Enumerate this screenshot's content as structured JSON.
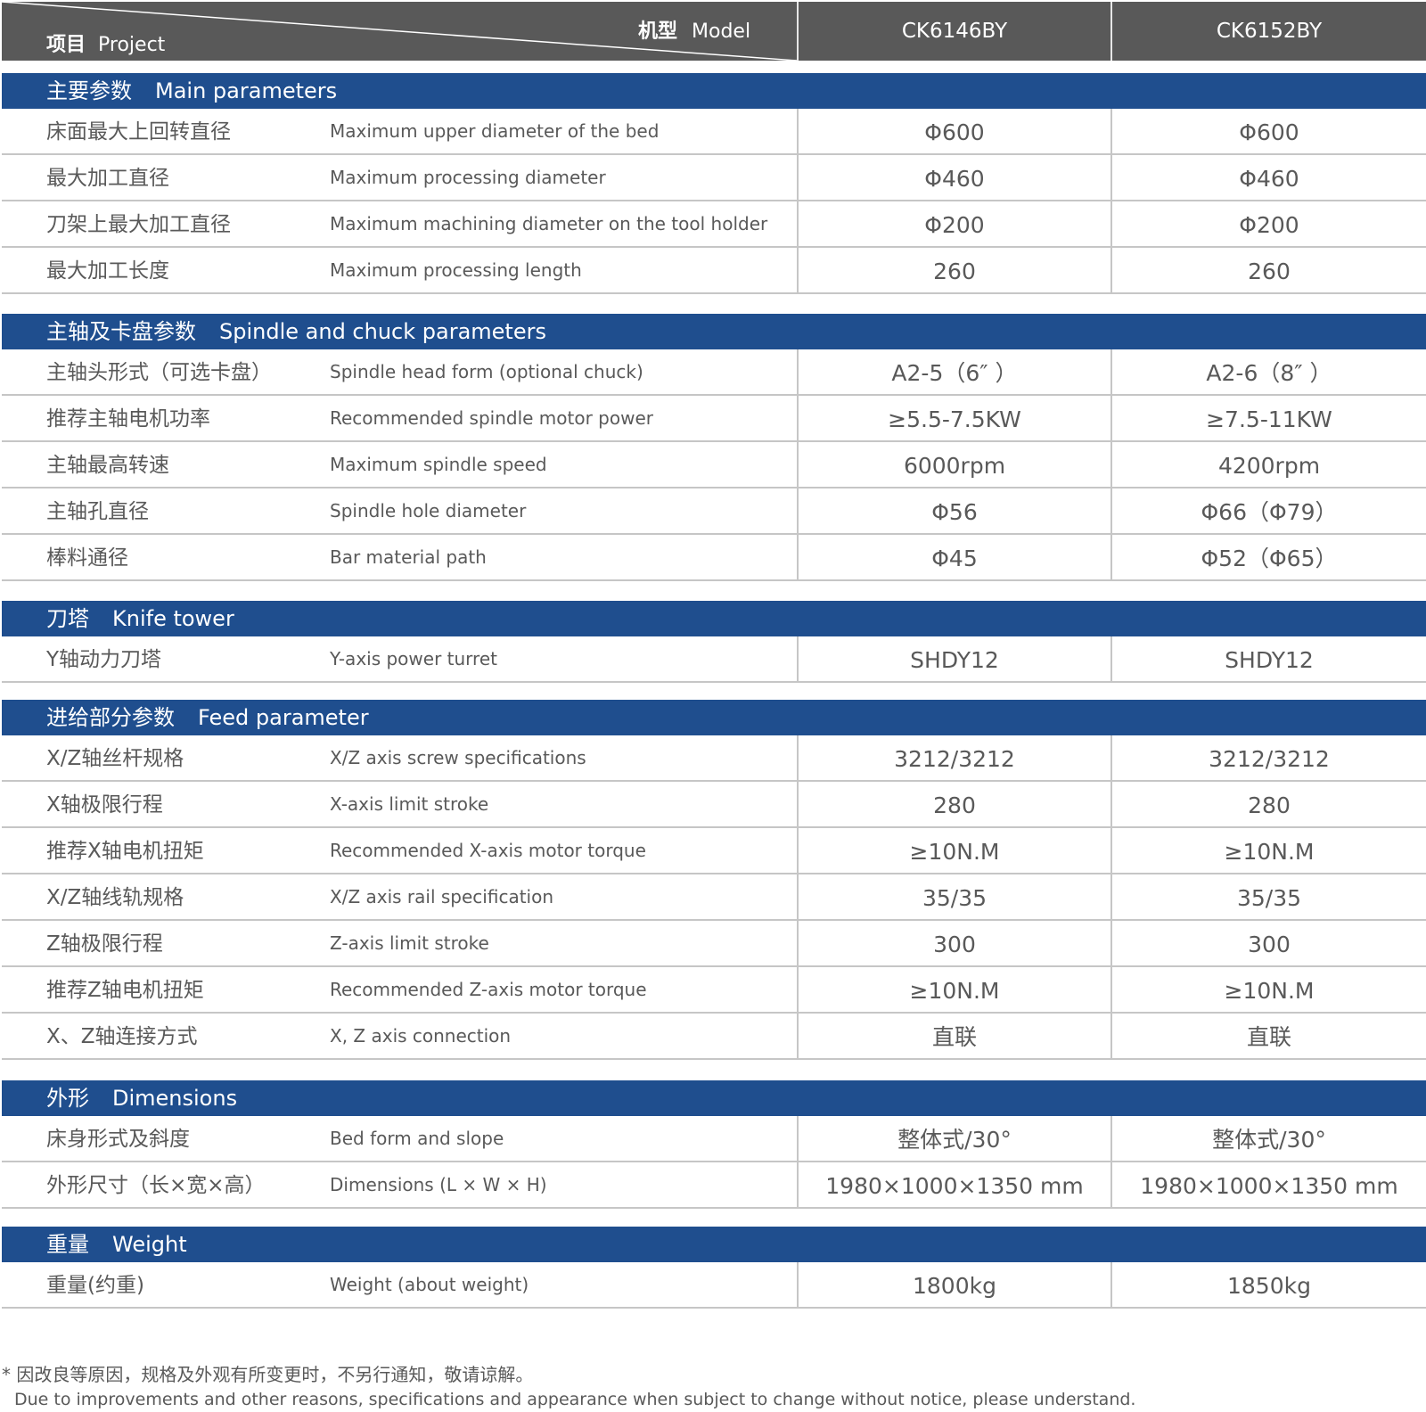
{
  "header": {
    "project_cn": "项目",
    "project_en": "Project",
    "model_cn": "机型",
    "model_en": "Model",
    "models": [
      "CK6146BY",
      "CK6152BY"
    ]
  },
  "sections": [
    {
      "title_cn": "主要参数",
      "title_en": "Main parameters",
      "rows": [
        {
          "cn": "床面最大上回转直径",
          "en": "Maximum upper diameter of the bed",
          "v1": "Φ600",
          "v2": "Φ600"
        },
        {
          "cn": "最大加工直径",
          "en": "Maximum processing diameter",
          "v1": "Φ460",
          "v2": "Φ460"
        },
        {
          "cn": "刀架上最大加工直径",
          "en": "Maximum machining diameter on the tool holder",
          "v1": "Φ200",
          "v2": "Φ200"
        },
        {
          "cn": "最大加工长度",
          "en": "Maximum processing length",
          "v1": "260",
          "v2": "260"
        }
      ]
    },
    {
      "title_cn": "主轴及卡盘参数",
      "title_en": "Spindle and chuck parameters",
      "rows": [
        {
          "cn": "主轴头形式（可选卡盘）",
          "en": "Spindle head form (optional chuck)",
          "v1": "A2-5（6″ ）",
          "v2": "A2-6（8″ ）"
        },
        {
          "cn": "推荐主轴电机功率",
          "en": "Recommended spindle motor power",
          "v1": "≥5.5-7.5KW",
          "v2": "≥7.5-11KW"
        },
        {
          "cn": "主轴最高转速",
          "en": "Maximum spindle speed",
          "v1": "6000rpm",
          "v2": "4200rpm"
        },
        {
          "cn": "主轴孔直径",
          "en": "Spindle hole diameter",
          "v1": "Φ56",
          "v2": "Φ66（Φ79）"
        },
        {
          "cn": "棒料通径",
          "en": "Bar material path",
          "v1": "Φ45",
          "v2": "Φ52（Φ65）"
        }
      ]
    },
    {
      "title_cn": "刀塔",
      "title_en": "Knife tower",
      "rows": [
        {
          "cn": "Y轴动力刀塔",
          "en": "Y-axis power turret",
          "v1": "SHDY12",
          "v2": "SHDY12"
        }
      ]
    },
    {
      "title_cn": "进给部分参数",
      "title_en": "Feed parameter",
      "rows": [
        {
          "cn": "X/Z轴丝杆规格",
          "en": "X/Z axis screw specifications",
          "v1": "3212/3212",
          "v2": "3212/3212"
        },
        {
          "cn": "X轴极限行程",
          "en": "X-axis limit stroke",
          "v1": "280",
          "v2": "280"
        },
        {
          "cn": "推荐X轴电机扭矩",
          "en": "Recommended X-axis motor torque",
          "v1": "≥10N.M",
          "v2": "≥10N.M"
        },
        {
          "cn": "X/Z轴线轨规格",
          "en": "X/Z axis rail specification",
          "v1": "35/35",
          "v2": "35/35"
        },
        {
          "cn": "Z轴极限行程",
          "en": "Z-axis limit stroke",
          "v1": "300",
          "v2": "300"
        },
        {
          "cn": "推荐Z轴电机扭矩",
          "en": "Recommended Z-axis motor torque",
          "v1": "≥10N.M",
          "v2": "≥10N.M"
        },
        {
          "cn": "X、Z轴连接方式",
          "en": "X, Z axis connection",
          "v1": "直联",
          "v2": "直联"
        }
      ]
    },
    {
      "title_cn": "外形",
      "title_en": "Dimensions",
      "rows": [
        {
          "cn": "床身形式及斜度",
          "en": "Bed form and slope",
          "v1": "整体式/30°",
          "v2": "整体式/30°"
        },
        {
          "cn": "外形尺寸（长×宽×高）",
          "en": "Dimensions (L × W × H)",
          "v1": "1980×1000×1350 mm",
          "v2": "1980×1000×1350 mm"
        }
      ]
    },
    {
      "title_cn": "重量",
      "title_en": "Weight",
      "rows": [
        {
          "cn": "重量(约重)",
          "en": "Weight (about weight)",
          "v1": "1800kg",
          "v2": "1850kg"
        }
      ]
    }
  ],
  "note": {
    "line1": "* 因改良等原因，规格及外观有所变更时，不另行通知，敬请谅解。",
    "line2": "Due to improvements and other reasons, specifications and appearance when subject to change without notice, please understand."
  },
  "colors": {
    "header_bg": "#595959",
    "section_bg": "#1f4e8e",
    "grid": "#c6c6c6",
    "text": "#595959"
  }
}
